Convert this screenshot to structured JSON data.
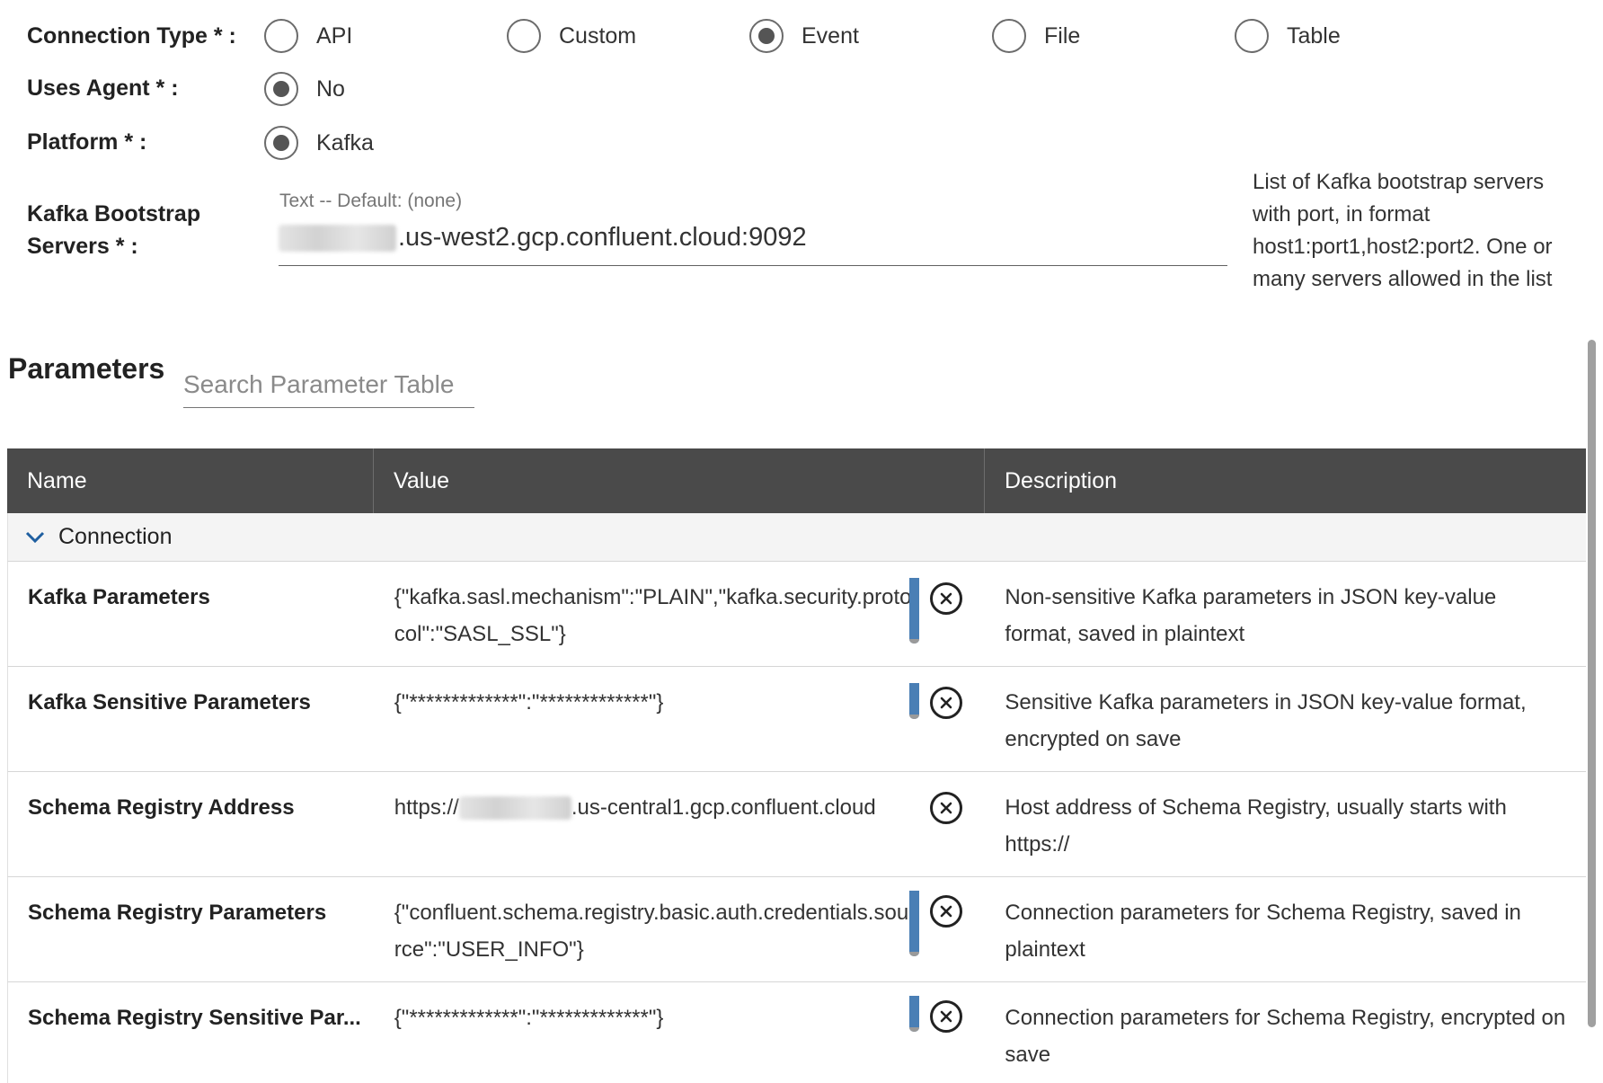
{
  "connection_type": {
    "label": "Connection Type * :",
    "options": [
      "API",
      "Custom",
      "Event",
      "File",
      "Table"
    ],
    "selected": "Event"
  },
  "uses_agent": {
    "label": "Uses Agent * :",
    "option": "No",
    "selected": true
  },
  "platform": {
    "label": "Platform * :",
    "option": "Kafka",
    "selected": true
  },
  "bootstrap": {
    "label": "Kafka Bootstrap Servers * :",
    "hint": "Text -- Default: (none)",
    "value_suffix": ".us-west2.gcp.confluent.cloud:9092",
    "help": "List of Kafka bootstrap servers with port, in format host1:port1,host2:port2. One or many servers allowed in the list"
  },
  "parameters": {
    "title": "Parameters",
    "search_placeholder": "Search Parameter Table",
    "columns": [
      "Name",
      "Value",
      "Description"
    ],
    "group": "Connection",
    "rows": [
      {
        "name": "Kafka Parameters",
        "value": "{\"kafka.sasl.mechanism\":\"PLAIN\",\"kafka.security.protocol\":\"SASL_SSL\"}",
        "description": "Non-sensitive Kafka parameters in JSON key-value format, saved in plaintext"
      },
      {
        "name": "Kafka Sensitive Parameters",
        "value": "{\"*************\":\"*************\"}",
        "description": "Sensitive Kafka parameters in JSON key-value format, encrypted on save"
      },
      {
        "name": "Schema Registry Address",
        "value_prefix": "https://",
        "value_suffix": ".us-central1.gcp.confluent.cloud",
        "description": "Host address of Schema Registry, usually starts with https://"
      },
      {
        "name": "Schema Registry Parameters",
        "value": "{\"confluent.schema.registry.basic.auth.credentials.source\":\"USER_INFO\"}",
        "description": "Connection parameters for Schema Registry, saved in plaintext"
      },
      {
        "name": "Schema Registry Sensitive Par...",
        "value": "{\"*************\":\"*************\"}",
        "description": "Connection parameters for Schema Registry, encrypted on save"
      }
    ]
  },
  "colors": {
    "header_bg": "#4a4a4a",
    "accent_bar": "#4a7fb5",
    "group_bg": "#f4f4f4"
  }
}
